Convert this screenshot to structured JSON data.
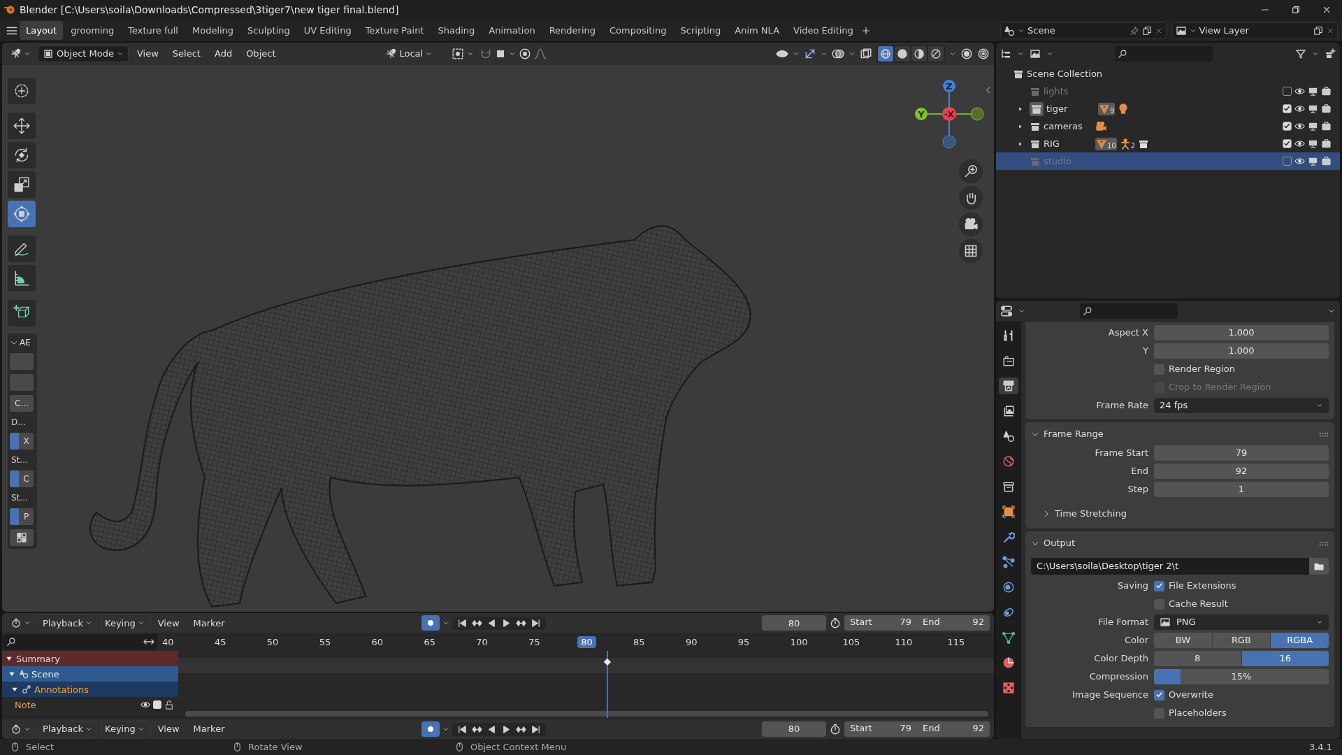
{
  "window": {
    "title": "Blender [C:\\Users\\soila\\Downloads\\Compressed\\3tiger7\\new tiger final.blend]"
  },
  "workspace_tabs": [
    {
      "label": "Layout",
      "selected": true
    },
    {
      "label": "grooming",
      "selected": false
    },
    {
      "label": "Texture full",
      "selected": false
    },
    {
      "label": "Modeling",
      "selected": false
    },
    {
      "label": "Sculpting",
      "selected": false
    },
    {
      "label": "UV Editing",
      "selected": false
    },
    {
      "label": "Texture Paint",
      "selected": false
    },
    {
      "label": "Shading",
      "selected": false
    },
    {
      "label": "Animation",
      "selected": false
    },
    {
      "label": "Rendering",
      "selected": false
    },
    {
      "label": "Compositing",
      "selected": false
    },
    {
      "label": "Scripting",
      "selected": false
    },
    {
      "label": "Anim NLA",
      "selected": false
    },
    {
      "label": "Video Editing",
      "selected": false
    }
  ],
  "scene_selector": {
    "scene": "Scene",
    "view_layer": "View Layer"
  },
  "viewport": {
    "mode": "Object Mode",
    "menus": [
      "View",
      "Select",
      "Add",
      "Object"
    ],
    "orientation": "Local",
    "shading_modes": [
      {
        "kind": "wireframe",
        "selected": true
      },
      {
        "kind": "solid",
        "selected": false
      },
      {
        "kind": "material",
        "selected": false
      },
      {
        "kind": "rendered",
        "selected": false
      }
    ],
    "tools": [
      {
        "kind": "cursor",
        "selected": false
      },
      {
        "kind": "move",
        "selected": false
      },
      {
        "kind": "rotate",
        "selected": false
      },
      {
        "kind": "scale",
        "selected": false
      },
      {
        "kind": "transform",
        "selected": true
      },
      {
        "kind": "annotate",
        "selected": false
      },
      {
        "kind": "measure",
        "selected": false
      },
      {
        "kind": "add_cube",
        "selected": false
      }
    ],
    "tool_panel": {
      "title": "AE",
      "expanded": true,
      "items": [
        {
          "kind": "blank"
        },
        {
          "kind": "blank"
        },
        {
          "kind": "button",
          "text": "C..."
        },
        {
          "kind": "label",
          "text": "D..."
        },
        {
          "kind": "toggle",
          "text": "X"
        },
        {
          "kind": "label",
          "text": "St..."
        },
        {
          "kind": "toggle",
          "text": "C"
        },
        {
          "kind": "label",
          "text": "St..."
        },
        {
          "kind": "toggle",
          "text": "P"
        },
        {
          "kind": "icon_button"
        }
      ]
    },
    "gizmo": {
      "z": "Z",
      "y": "Y",
      "x": "-X"
    }
  },
  "outliner": {
    "root": {
      "name": "Scene Collection",
      "children": [
        {
          "name": "lights",
          "expandable": false,
          "included": false,
          "selected": false,
          "active": false
        },
        {
          "name": "tiger",
          "expandable": true,
          "included": true,
          "selected": false,
          "active": true,
          "badges": [
            {
              "kind": "mesh",
              "count": "9"
            },
            {
              "kind": "light"
            }
          ]
        },
        {
          "name": "cameras",
          "expandable": true,
          "included": true,
          "selected": false,
          "active": false,
          "badges": [
            {
              "kind": "camera"
            }
          ]
        },
        {
          "name": "RIG",
          "expandable": true,
          "included": true,
          "selected": false,
          "active": false,
          "badges": [
            {
              "kind": "mesh",
              "count": "10"
            },
            {
              "kind": "armature",
              "count": "2"
            },
            {
              "kind": "collection"
            }
          ]
        },
        {
          "name": "studio",
          "expandable": false,
          "included": false,
          "selected": true,
          "active": false
        }
      ]
    }
  },
  "properties": {
    "tabs": [
      {
        "kind": "tool",
        "selected": false
      },
      {
        "kind": "render",
        "selected": false
      },
      {
        "kind": "output",
        "selected": true
      },
      {
        "kind": "view_layer",
        "selected": false
      },
      {
        "kind": "scene",
        "selected": false
      },
      {
        "kind": "world",
        "selected": false
      },
      {
        "kind": "collection",
        "selected": false
      },
      {
        "kind": "object",
        "selected": false
      },
      {
        "kind": "modifiers",
        "selected": false
      },
      {
        "kind": "particles",
        "selected": false
      },
      {
        "kind": "physics",
        "selected": false
      },
      {
        "kind": "constraints",
        "selected": false
      },
      {
        "kind": "data",
        "selected": false
      },
      {
        "kind": "material",
        "selected": false
      },
      {
        "kind": "texture",
        "selected": false
      }
    ],
    "panels": [
      {
        "rows": [
          {
            "kind": "number",
            "label": "Aspect X",
            "value": "1.000"
          },
          {
            "kind": "number",
            "label": "Y",
            "value": "1.000"
          },
          {
            "kind": "checkbox",
            "text": "Render Region",
            "checked": false,
            "disabled": false
          },
          {
            "kind": "checkbox",
            "text": "Crop to Render Region",
            "checked": false,
            "disabled": true
          },
          {
            "kind": "dropdown",
            "label": "Frame Rate",
            "value": "24 fps"
          }
        ]
      },
      {
        "title": "Frame Range",
        "expanded": true,
        "rows": [
          {
            "kind": "number",
            "label": "Frame Start",
            "value": "79"
          },
          {
            "kind": "number",
            "label": "End",
            "value": "92"
          },
          {
            "kind": "number",
            "label": "Step",
            "value": "1"
          },
          {
            "kind": "subpanel",
            "title": "Time Stretching",
            "expanded": false
          }
        ]
      },
      {
        "title": "Output",
        "expanded": true,
        "rows": [
          {
            "kind": "path",
            "value": "C:\\Users\\soila\\Desktop\\tiger 2\\t"
          },
          {
            "kind": "checkbox",
            "label": "Saving",
            "text": "File Extensions",
            "checked": true,
            "disabled": false
          },
          {
            "kind": "checkbox",
            "text": "Cache Result",
            "checked": false,
            "disabled": false
          },
          {
            "kind": "format_dropdown",
            "label": "File Format",
            "value": "PNG"
          },
          {
            "kind": "segmented",
            "label": "Color",
            "options": [
              {
                "label": "BW",
                "selected": false
              },
              {
                "label": "RGB",
                "selected": false
              },
              {
                "label": "RGBA",
                "selected": true
              }
            ]
          },
          {
            "kind": "segmented",
            "label": "Color Depth",
            "options": [
              {
                "label": "8",
                "selected": false
              },
              {
                "label": "16",
                "selected": true
              }
            ]
          },
          {
            "kind": "slider",
            "label": "Compression",
            "value": "15%",
            "level": 0.15
          },
          {
            "kind": "checkbox",
            "label": "Image Sequence",
            "text": "Overwrite",
            "checked": true,
            "disabled": false
          },
          {
            "kind": "checkbox",
            "text": "Placeholders",
            "checked": false,
            "disabled": false
          }
        ]
      }
    ]
  },
  "timeline": {
    "headers": [
      {
        "menus": [
          "Playback",
          "Keying",
          "View",
          "Marker"
        ],
        "auto_keying": true,
        "current_frame": "80",
        "start_label": "Start",
        "start": "79",
        "end_label": "End",
        "end": "92"
      },
      {
        "menus": [
          "Playback",
          "Keying",
          "View",
          "Marker"
        ],
        "auto_keying": true,
        "current_frame": "80",
        "start_label": "Start",
        "start": "79",
        "end_label": "End",
        "end": "92"
      }
    ],
    "ruler": [
      {
        "label": "40",
        "selected": false
      },
      {
        "label": "45",
        "selected": false
      },
      {
        "label": "50",
        "selected": false
      },
      {
        "label": "55",
        "selected": false
      },
      {
        "label": "60",
        "selected": false
      },
      {
        "label": "65",
        "selected": false
      },
      {
        "label": "70",
        "selected": false
      },
      {
        "label": "75",
        "selected": false
      },
      {
        "label": "80",
        "selected": true
      },
      {
        "label": "85",
        "selected": false
      },
      {
        "label": "90",
        "selected": false
      },
      {
        "label": "95",
        "selected": false
      },
      {
        "label": "100",
        "selected": false
      },
      {
        "label": "105",
        "selected": false
      },
      {
        "label": "110",
        "selected": false
      },
      {
        "label": "115",
        "selected": false
      }
    ],
    "channels": [
      {
        "kind": "summary",
        "name": "Summary",
        "expanded": true,
        "children": [
          {
            "kind": "scene",
            "name": "Scene",
            "expanded": true,
            "children": [
              {
                "kind": "object",
                "name": "Annotations",
                "expanded": true,
                "children": [
                  {
                    "kind": "layer",
                    "name": "Note",
                    "checked": true
                  }
                ]
              }
            ]
          }
        ]
      }
    ]
  },
  "status_bar": {
    "hints": [
      "Select",
      "Rotate View",
      "Object Context Menu"
    ],
    "version": "3.4.1"
  }
}
